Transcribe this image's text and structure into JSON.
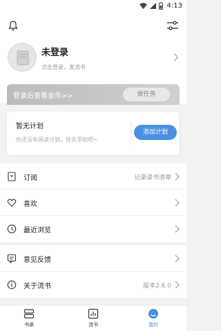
{
  "status": {
    "time": "4:13"
  },
  "profile": {
    "title": "未登录",
    "subtitle": "点击登录，发流书"
  },
  "coin_banner": {
    "text": "登录后查看金币>>",
    "button": "做任务"
  },
  "plan": {
    "title": "暂无计划",
    "desc": "你还没有阅读计划，快去添加吧~",
    "button": "添加计划"
  },
  "menu1": [
    {
      "label": "订阅",
      "value": "记录读书清单"
    },
    {
      "label": "喜欢",
      "value": ""
    },
    {
      "label": "最近浏览",
      "value": ""
    }
  ],
  "menu2": [
    {
      "label": "意见反馈",
      "value": ""
    },
    {
      "label": "关于流书",
      "value": "版本2.6.0"
    }
  ],
  "tabs": [
    {
      "label": "书桌"
    },
    {
      "label": "流书"
    },
    {
      "label": "我的"
    }
  ],
  "colors": {
    "accent": "#4a90e2",
    "active_tab": "#4a90e2"
  }
}
